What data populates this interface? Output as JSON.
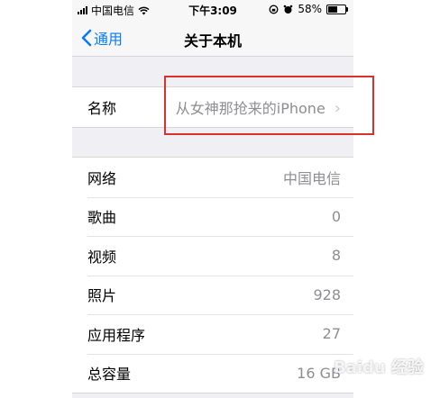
{
  "status_bar": {
    "carrier": "中国电信",
    "time": "下午3:09",
    "battery_percent": "58%",
    "battery_level": 0.58
  },
  "nav": {
    "back_label": "通用",
    "title": "关于本机"
  },
  "name_row": {
    "label": "名称",
    "value": "从女神那抢来的iPhone"
  },
  "info_rows": [
    {
      "label": "网络",
      "value": "中国电信"
    },
    {
      "label": "歌曲",
      "value": "0"
    },
    {
      "label": "视频",
      "value": "8"
    },
    {
      "label": "照片",
      "value": "928"
    },
    {
      "label": "应用程序",
      "value": "27"
    },
    {
      "label": "总容量",
      "value": "16 GB"
    }
  ],
  "watermark": "Baidu 经验",
  "colors": {
    "accent": "#0a7aff",
    "highlight_box": "#d9312b",
    "background": "#efeff4"
  }
}
